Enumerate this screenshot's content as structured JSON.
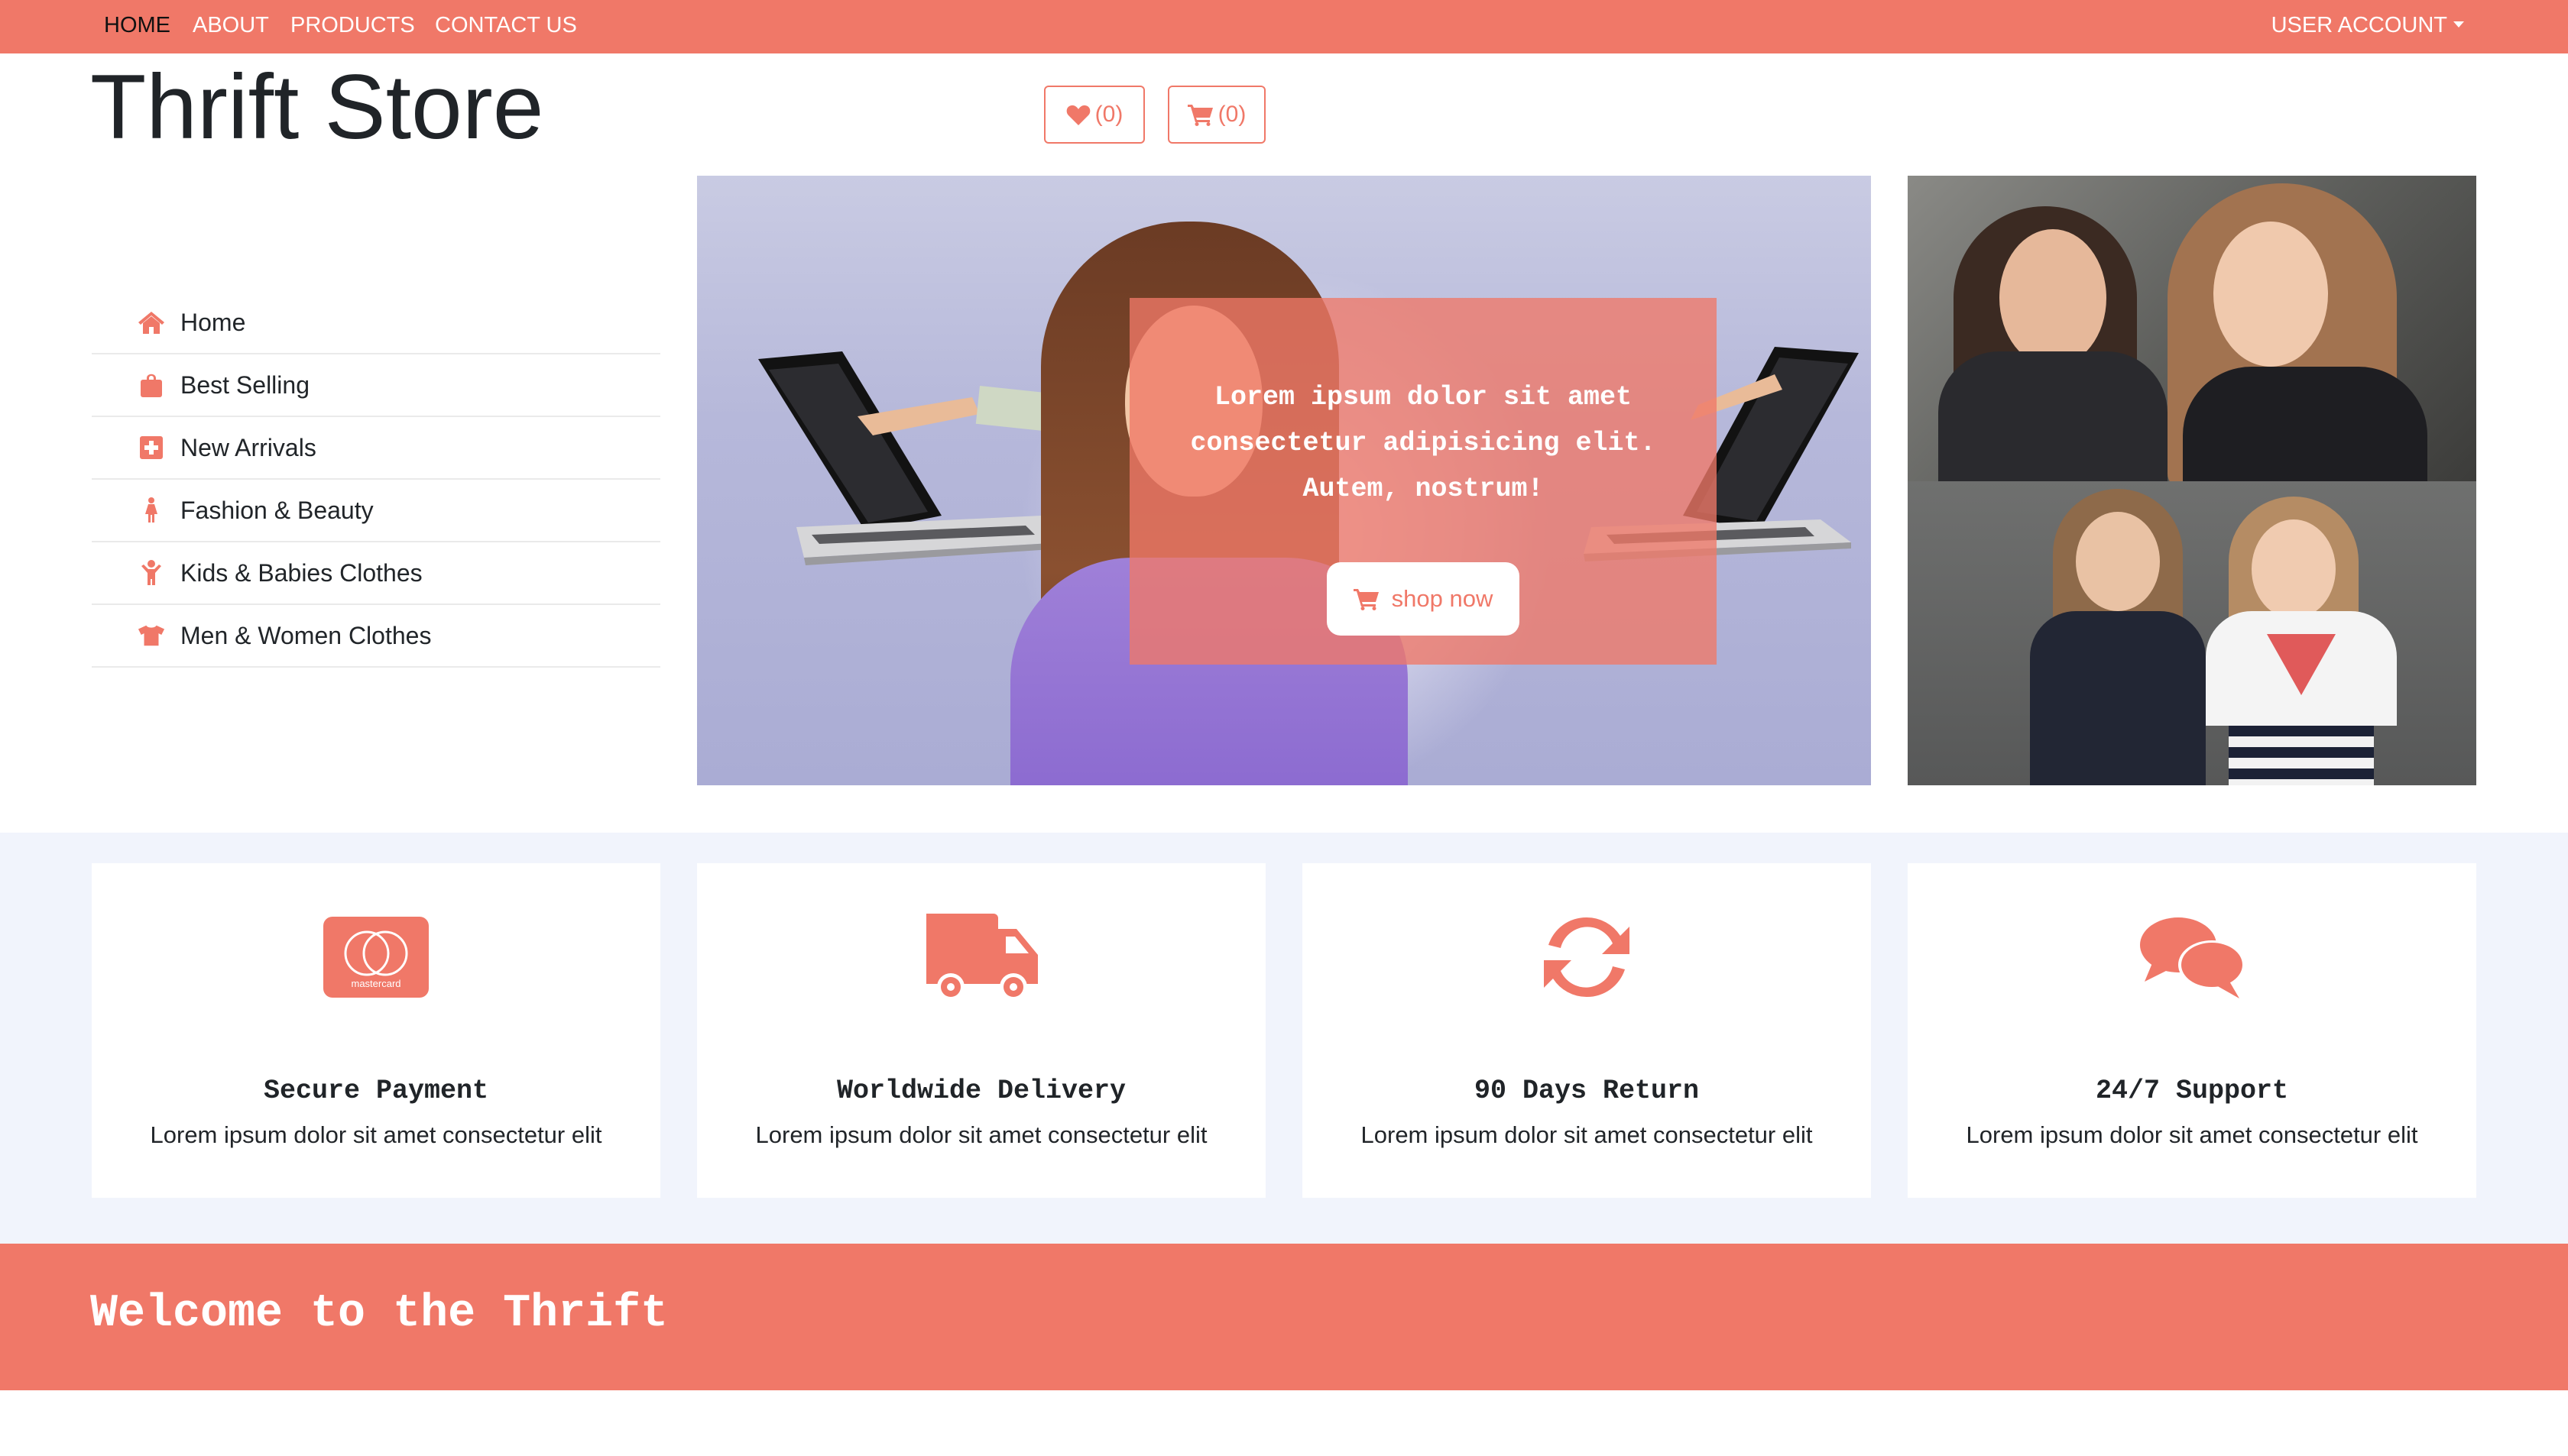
{
  "nav": {
    "links": [
      {
        "label": "HOME",
        "active": true
      },
      {
        "label": "ABOUT",
        "active": false
      },
      {
        "label": "PRODUCTS",
        "active": false
      },
      {
        "label": "CONTACT US",
        "active": false
      }
    ],
    "account_label": "USER ACCOUNT"
  },
  "header": {
    "brand": "Thrift Store",
    "wishlist_count": "(0)",
    "cart_count": "(0)"
  },
  "sidebar": {
    "items": [
      {
        "label": "Home",
        "icon": "home-icon"
      },
      {
        "label": "Best Selling",
        "icon": "shopping-bag-icon"
      },
      {
        "label": "New Arrivals",
        "icon": "plus-square-icon"
      },
      {
        "label": "Fashion & Beauty",
        "icon": "female-icon"
      },
      {
        "label": "Kids & Babies Clothes",
        "icon": "child-icon"
      },
      {
        "label": "Men & Women Clothes",
        "icon": "tshirt-icon"
      }
    ]
  },
  "hero": {
    "text": "Lorem ipsum dolor sit amet consectetur adipisicing elit. Autem, nostrum!",
    "button_label": "shop now"
  },
  "features": [
    {
      "title": "Secure Payment",
      "desc": "Lorem ipsum dolor sit amet consectetur elit",
      "icon": "mastercard-icon",
      "card_text": "mastercard"
    },
    {
      "title": "Worldwide Delivery",
      "desc": "Lorem ipsum dolor sit amet consectetur elit",
      "icon": "truck-icon"
    },
    {
      "title": "90 Days Return",
      "desc": "Lorem ipsum dolor sit amet consectetur elit",
      "icon": "refresh-icon"
    },
    {
      "title": "24/7 Support",
      "desc": "Lorem ipsum dolor sit amet consectetur elit",
      "icon": "comments-icon"
    }
  ],
  "welcome": {
    "title": "Welcome to the Thrift"
  },
  "colors": {
    "accent": "#f07868",
    "features_bg": "#f1f4fc",
    "text": "#212529"
  }
}
